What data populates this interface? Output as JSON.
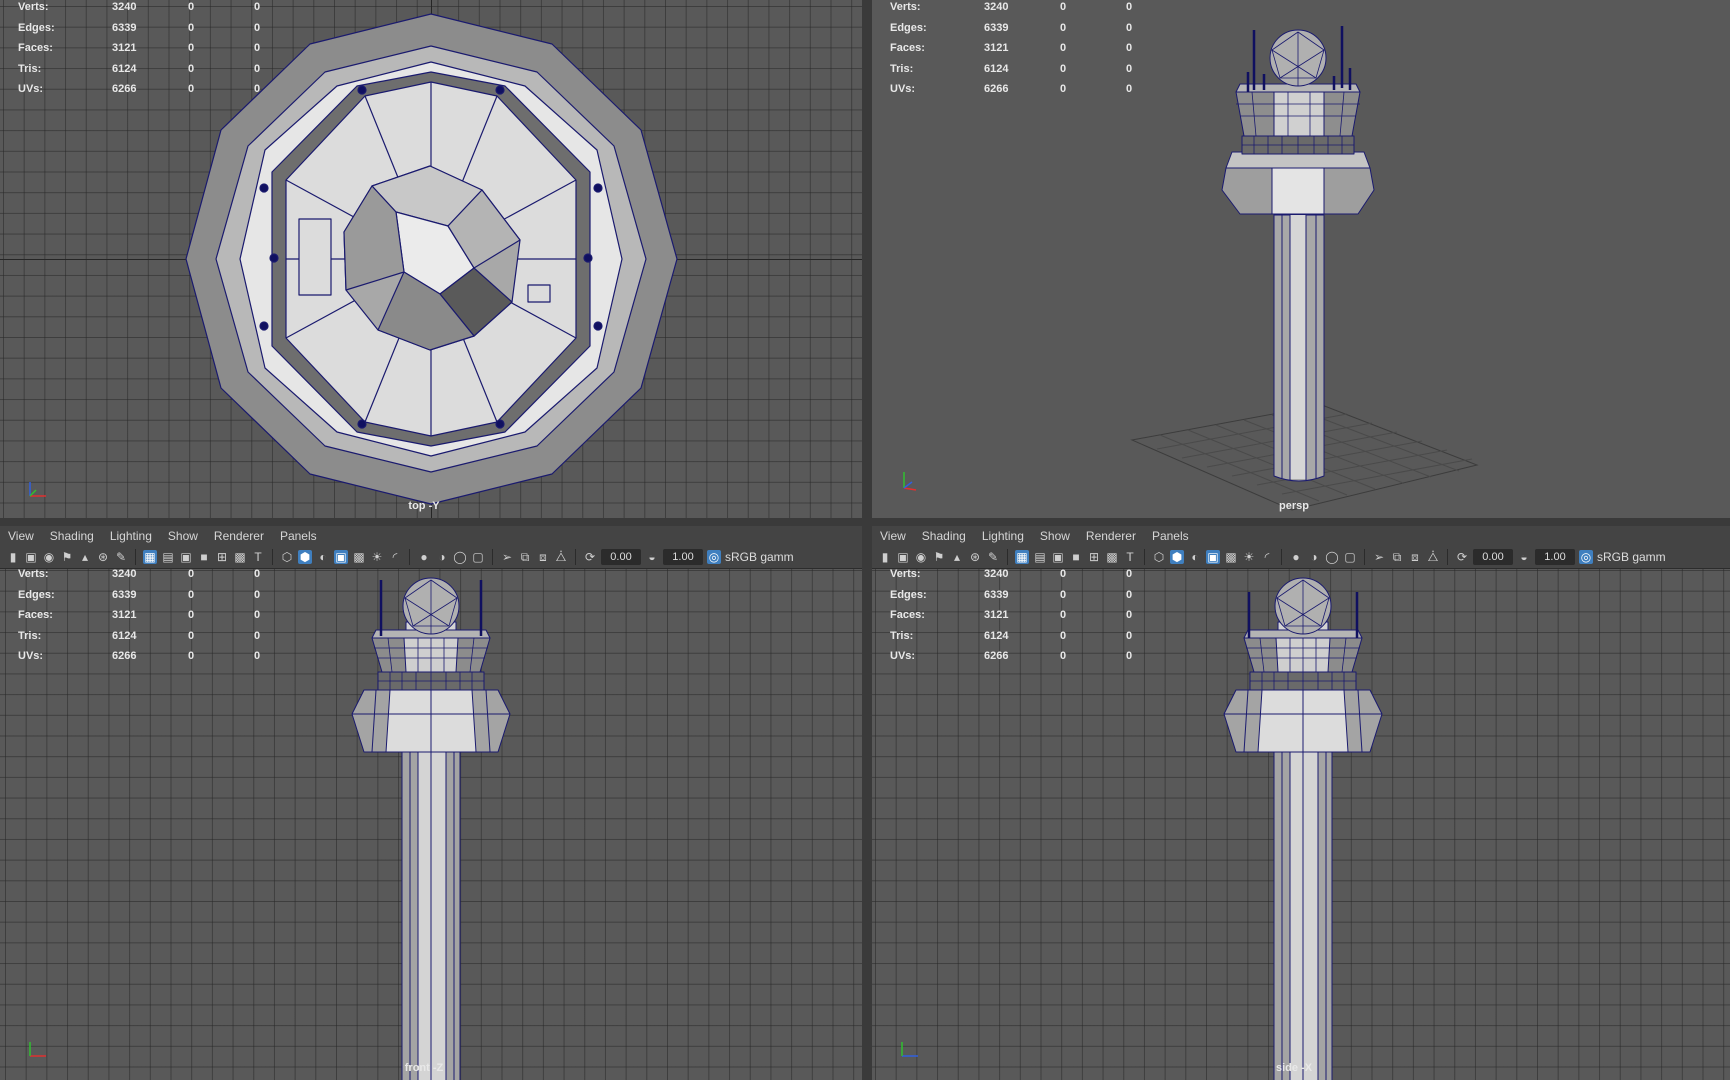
{
  "menus": [
    "View",
    "Shading",
    "Lighting",
    "Show",
    "Renderer",
    "Panels"
  ],
  "toolbar": {
    "exposure": "0.00",
    "gamma": "1.00",
    "color_space": "sRGB gamm"
  },
  "hud": {
    "rows": [
      {
        "label": "Verts:",
        "value": "3240",
        "sel": "0",
        "uv": "0"
      },
      {
        "label": "Edges:",
        "value": "6339",
        "sel": "0",
        "uv": "0"
      },
      {
        "label": "Faces:",
        "value": "3121",
        "sel": "0",
        "uv": "0"
      },
      {
        "label": "Tris:",
        "value": "6124",
        "sel": "0",
        "uv": "0"
      },
      {
        "label": "UVs:",
        "value": "6266",
        "sel": "0",
        "uv": "0"
      }
    ]
  },
  "panes": {
    "top": {
      "camera": "top -Y"
    },
    "persp": {
      "camera": "persp"
    },
    "front": {
      "camera": "front -Z"
    },
    "side": {
      "camera": "side -X"
    }
  },
  "colors": {
    "viewport_bg": "#595959",
    "wire": "#1a1a6e",
    "surface_light": "#d8d8d8",
    "surface_mid": "#9a9a9a",
    "surface_dark": "#6e6e6e",
    "accent": "#3f7fbf"
  },
  "icons": [
    "camera-icon",
    "select-camera-icon",
    "bookmark-icon",
    "grid-icon",
    "wireframe-icon",
    "smooth-shade-icon",
    "textured-icon",
    "lights-icon",
    "shadows-icon",
    "isolate-icon",
    "exposure-icon",
    "gamma-icon",
    "color-management-icon"
  ]
}
